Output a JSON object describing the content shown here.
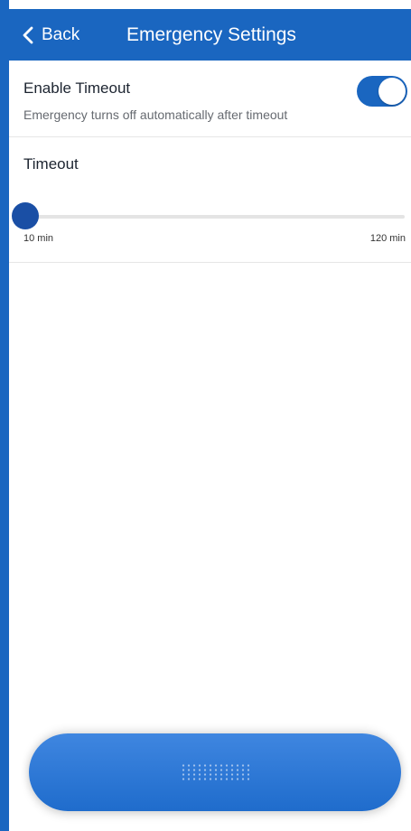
{
  "header": {
    "back_label": "Back",
    "title": "Emergency Settings"
  },
  "settings": {
    "enable_timeout": {
      "label": "Enable Timeout",
      "description": "Emergency turns off automatically after timeout",
      "enabled": true
    },
    "timeout": {
      "label": "Timeout",
      "min_label": "10 min",
      "max_label": "120 min",
      "min": 10,
      "max": 120,
      "value": 10
    }
  },
  "bottom_bar": {
    "icon": "grip-dots-icon"
  },
  "colors": {
    "accent": "#1a66c0",
    "thumb": "#1a4fa5",
    "bottom_bar": "#2a76d2"
  }
}
